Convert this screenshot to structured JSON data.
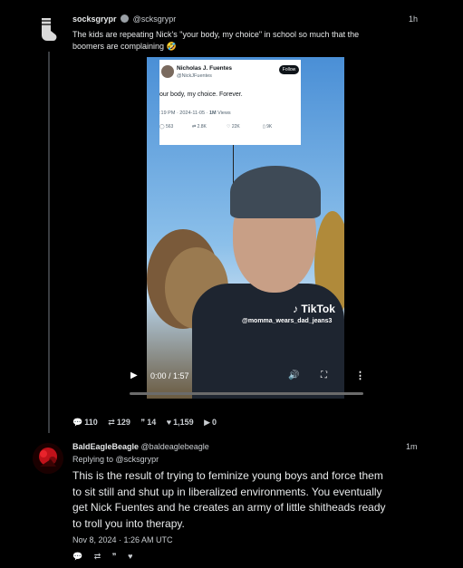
{
  "post1": {
    "name": "socksgrypr",
    "handle": "@scksgrypr",
    "time": "1h",
    "text_line1": "The kids are repeating Nick's \"your body, my choice\" in school so much that the",
    "text_line2": "boomers are complaining 🤣",
    "stats": {
      "replies": "110",
      "reposts": "129",
      "quotes": "14",
      "likes": "1,159",
      "bookmarks": "0"
    }
  },
  "embedded_tweet": {
    "name": "Nicholas J. Fuentes",
    "handle": "@NickJFuentes",
    "follow_label": "Follow",
    "text": "our body, my choice. Forever.",
    "meta_time": ":19 PM · 2024-11-05 · ",
    "meta_views": "1M",
    "meta_views_label": " Views",
    "replies": "563",
    "reposts": "2.8K",
    "likes": "22K",
    "bookmarks": "9K"
  },
  "video": {
    "tiktok_label": "TikTok",
    "tiktok_user": "@momma_wears_dad_jeans3",
    "time": "0:00 / 1:57",
    "progress": 0
  },
  "post2": {
    "name": "BaldEagleBeagle",
    "handle": "@baldeaglebeagle",
    "time": "1m",
    "replying_to_prefix": "Replying to ",
    "replying_to": "@scksgrypr",
    "text_line1": "This is the result of trying to feminize young boys and force them",
    "text_line2": "to sit still and shut up in liberalized environments. You eventually",
    "text_line3": "get Nick Fuentes and he creates an army of little shitheads ready",
    "text_line4": "to troll you into therapy.",
    "date": "Nov 8, 2024 · 1:26 AM UTC"
  },
  "icons": {
    "reply": "reply-icon",
    "repost": "repost-icon",
    "quote": "quote-icon",
    "like": "heart-icon",
    "bookmark": "play-icon"
  }
}
